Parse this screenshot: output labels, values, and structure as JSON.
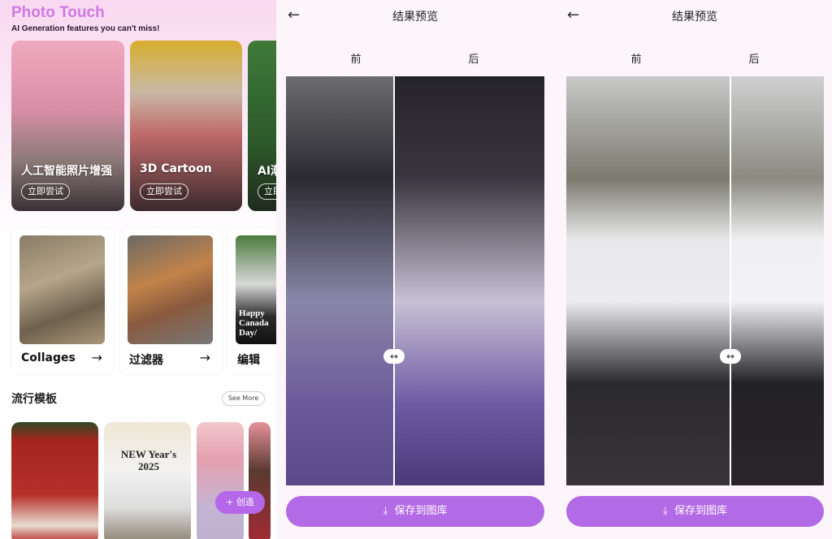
{
  "home": {
    "app_title": "Photo Touch",
    "subtitle": "AI Generation features you can't miss!",
    "feature_cards": [
      {
        "label": "人工智能照片增强",
        "button": "立即尝试"
      },
      {
        "label": "3D Cartoon",
        "button": "立即尝试"
      },
      {
        "label": "AI潮",
        "button": "立即"
      }
    ],
    "tools": [
      {
        "label": "Collages",
        "arrow": "→"
      },
      {
        "label": "过滤器",
        "arrow": "→"
      },
      {
        "label": "编辑",
        "image_text": "Happy Canada Day/"
      }
    ],
    "section_title": "流行模板",
    "see_more": "See More",
    "templates": [
      {
        "image_text": ""
      },
      {
        "image_text": "NEW Year's 2025"
      },
      {
        "image_text": ""
      },
      {
        "image_text": ""
      }
    ],
    "fab_label": "+ 创造"
  },
  "preview_screens": [
    {
      "back_icon": "arrow-left-icon",
      "title": "结果预览",
      "before": "前",
      "after": "后",
      "handle_icon": "↔",
      "save_button": "保存到图库",
      "download_icon": "download-icon"
    },
    {
      "back_icon": "arrow-left-icon",
      "title": "结果预览",
      "before": "前",
      "after": "后",
      "handle_icon": "↔",
      "save_button": "保存到图库",
      "download_icon": "download-icon"
    }
  ],
  "colors": {
    "accent": "#b36ae6",
    "title": "#cf79e3"
  }
}
